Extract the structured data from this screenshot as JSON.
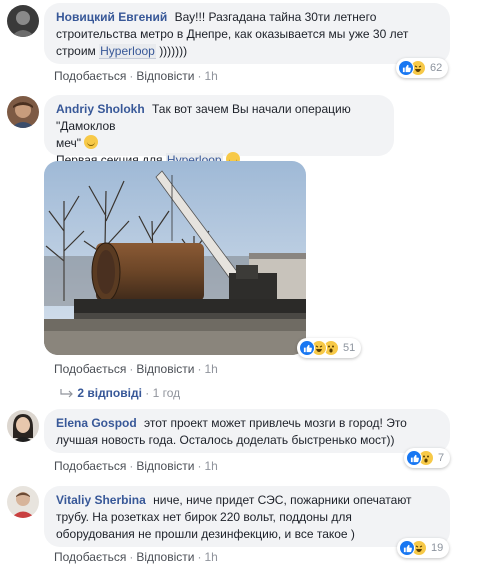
{
  "comments": [
    {
      "author": "Новицкий Евгений",
      "text_1": "Вау!!! Разгадана тайна 30ти летнего",
      "text_2": "строительства метро в Днепре, как оказывается мы уже 30 лет",
      "text_3_pre": "строим",
      "hashtag": "Hyperloop",
      "text_3_post": ")))))))",
      "like": "Подобається",
      "reply": "Відповісти",
      "time": "1h",
      "reaction_count": "62"
    },
    {
      "author": "Andriy Sholokh",
      "text_1": "Так вот зачем Вы начали операцию \"Дамоклов",
      "text_2": "меч\"",
      "text_3_pre": "Первая секция для",
      "hashtag": "Hyperloop",
      "like": "Подобається",
      "reply": "Відповісти",
      "time": "1h",
      "reaction_count": "51",
      "replies_label": "2 відповіді",
      "replies_time": "1 год"
    },
    {
      "author": "Elena Gospod",
      "text_1": "этот проект может привлечь мозги в город! Это",
      "text_2": "лучшая новость года. Осталось доделать быстренько мост))",
      "like": "Подобається",
      "reply": "Відповісти",
      "time": "1h",
      "reaction_count": "7"
    },
    {
      "author": "Vitaliy Sherbina",
      "text_1": "ниче, ниче придет СЭС, пожарники опечатают",
      "text_2": "трубу. На розетках нет бирок 220 вольт, поддоны для",
      "text_3": "оборудования не прошли дезинфекцию, и все такое )",
      "like": "Подобається",
      "reply": "Відповісти",
      "time": "1h",
      "reaction_count": "19"
    }
  ],
  "colors": {
    "link": "#385898",
    "bubble": "#f2f3f5",
    "meta": "#90949c",
    "like": "#1877f2",
    "haha": "#f7c948"
  },
  "icons": [
    "like-icon",
    "haha-icon",
    "wow-icon",
    "smile-emoji-icon",
    "reply-arrow-icon"
  ]
}
